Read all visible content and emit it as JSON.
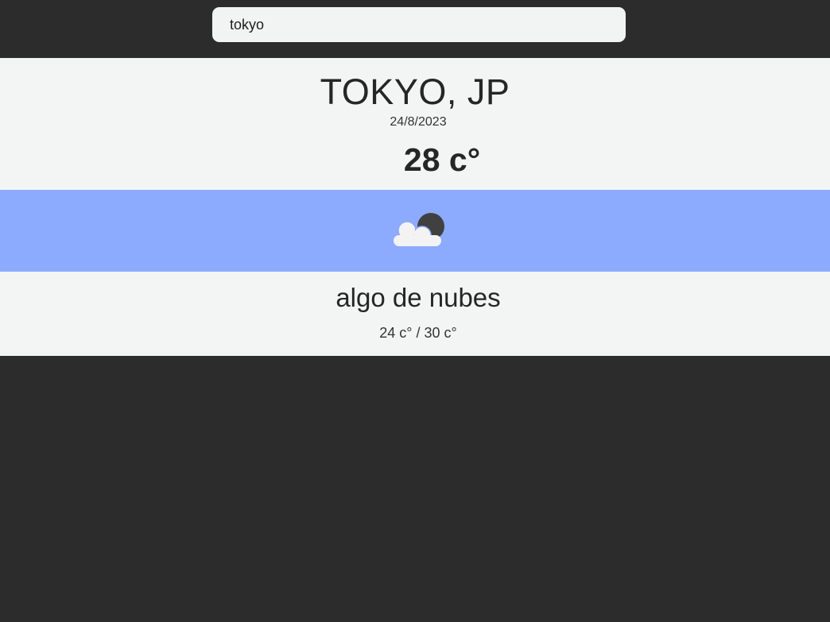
{
  "search": {
    "value": "tokyo"
  },
  "weather": {
    "location": "TOKYO, JP",
    "date": "24/8/2023",
    "temperature": "28 c°",
    "icon": "cloud-moon-icon",
    "description": "algo de nubes",
    "range": "24 c° / 30 c°"
  },
  "colors": {
    "background": "#2c2c2c",
    "card": "#f3f5f5",
    "icon_band": "#8cabff"
  }
}
